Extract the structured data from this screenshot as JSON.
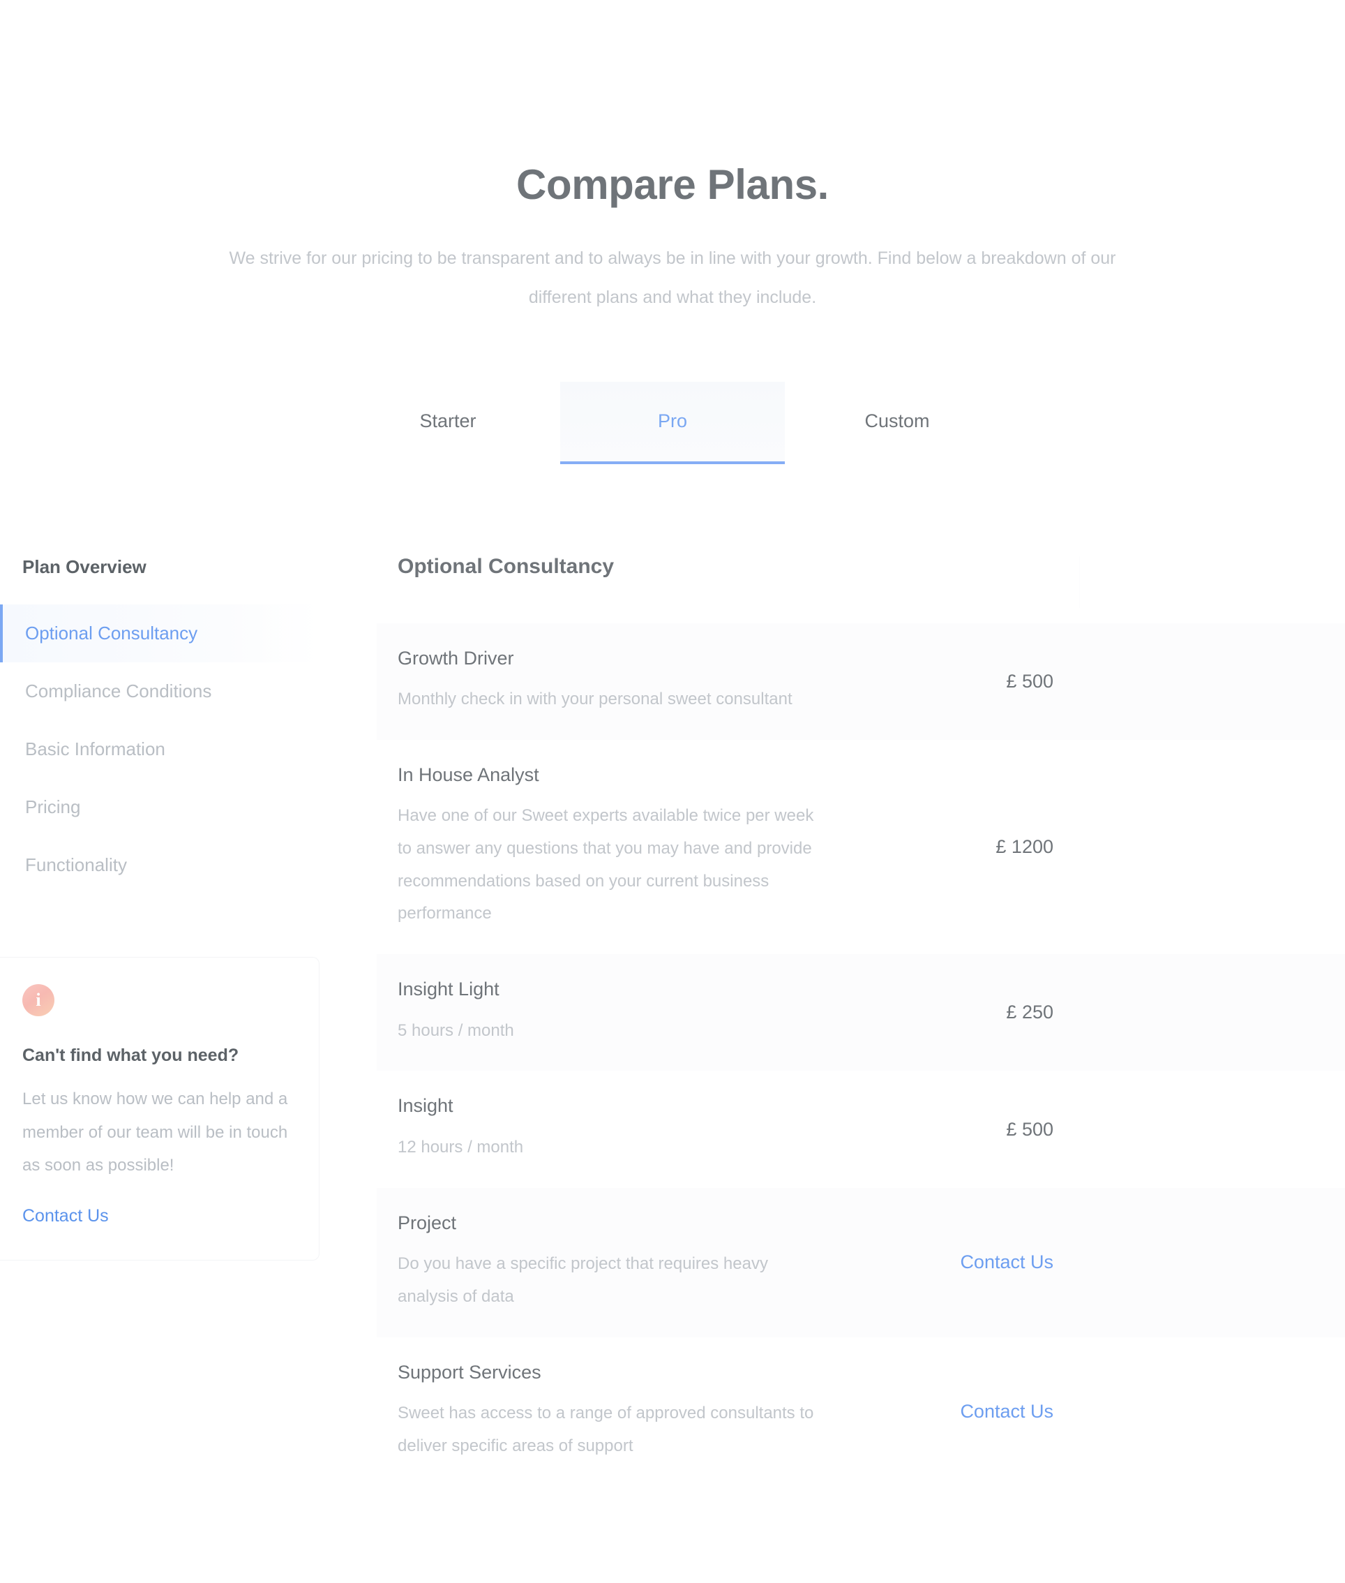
{
  "hero": {
    "title": "Compare Plans.",
    "subtitle": "We strive for our pricing to be transparent and to always be in line with your growth. Find below a breakdown of our different plans and what they include."
  },
  "tabs": {
    "items": [
      {
        "label": "Starter",
        "active": false
      },
      {
        "label": "Pro",
        "active": true
      },
      {
        "label": "Custom",
        "active": false
      }
    ]
  },
  "sidebar": {
    "heading": "Plan Overview",
    "items": [
      {
        "label": "Optional Consultancy",
        "active": true
      },
      {
        "label": "Compliance Conditions",
        "active": false
      },
      {
        "label": "Basic Information",
        "active": false
      },
      {
        "label": "Pricing",
        "active": false
      },
      {
        "label": "Functionality",
        "active": false
      }
    ],
    "help_card": {
      "icon": "info-icon",
      "icon_glyph": "i",
      "title": "Can't find what you need?",
      "body": "Let us know how we can help and a member of our team will be in touch as soon as possible!",
      "link_label": "Contact Us"
    }
  },
  "main": {
    "section_title": "Optional Consultancy",
    "rows": [
      {
        "title": "Growth Driver",
        "description": "Monthly check in with your personal sweet consultant",
        "value": "£ 500",
        "value_is_link": false
      },
      {
        "title": "In House Analyst",
        "description": "Have one of our Sweet experts available twice per week to answer any questions that you may have and provide recommendations based on your current business performance",
        "value": "£ 1200",
        "value_is_link": false
      },
      {
        "title": "Insight Light",
        "description": "5 hours / month",
        "value": "£ 250",
        "value_is_link": false
      },
      {
        "title": "Insight",
        "description": "12 hours / month",
        "value": "£ 500",
        "value_is_link": false
      },
      {
        "title": "Project",
        "description": "Do you have a specific project that requires heavy analysis of data",
        "value": "Contact Us",
        "value_is_link": true
      },
      {
        "title": "Support Services",
        "description": "Sweet has access to a range of approved consultants to deliver specific areas of support",
        "value": "Contact Us",
        "value_is_link": true
      }
    ]
  },
  "colors": {
    "accent_blue": "#6d9ef0",
    "tab_active_blue": "#7aa7f2",
    "heading_gray": "#6f7479",
    "muted_gray": "#c2c6cb",
    "row_alt_bg": "#fcfcfd",
    "info_icon_pink": "#f7b9b2"
  }
}
